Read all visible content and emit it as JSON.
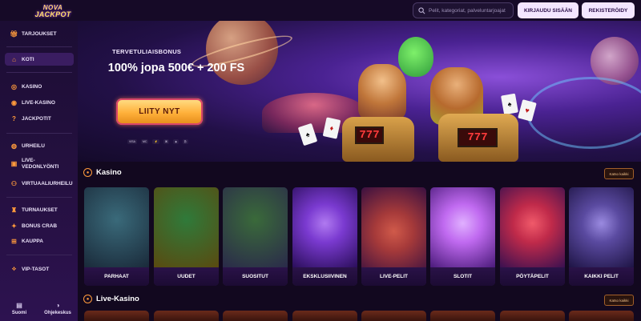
{
  "header": {
    "logo_line1": "NOVA",
    "logo_line2": "JACKPOT",
    "search_placeholder": "Pelit, kategoriat, palveluntarjoajat",
    "login_label": "KIRJAUDU SISÄÄN",
    "register_label": "REKISTERÖIDY"
  },
  "sidebar": {
    "items": [
      {
        "label": "TARJOUKSET",
        "icon": "gift-icon"
      },
      {
        "label": "KOTI",
        "icon": "home-icon",
        "active": true
      },
      {
        "label": "KASINO",
        "icon": "casino-chip-icon"
      },
      {
        "label": "LIVE-KASINO",
        "icon": "live-icon"
      },
      {
        "label": "JACKPOTIT",
        "icon": "jackpot-icon"
      },
      {
        "label": "URHEILU",
        "icon": "sports-icon"
      },
      {
        "label": "LIVE-VEDONLYÖNTI",
        "icon": "live-betting-icon"
      },
      {
        "label": "VIRTUAALIURHEILU",
        "icon": "virtual-sports-icon"
      },
      {
        "label": "TURNAUKSET",
        "icon": "trophy-icon"
      },
      {
        "label": "BONUS CRAB",
        "icon": "crab-icon"
      },
      {
        "label": "KAUPPA",
        "icon": "shop-icon"
      },
      {
        "label": "VIP-TASOT",
        "icon": "vip-icon"
      }
    ],
    "bottom": {
      "language_label": "Suomi",
      "help_label": "Ohjekeskus"
    }
  },
  "hero": {
    "kicker": "TERVETULIAISBONUS",
    "title": "100% jopa 500€ + 200 FS",
    "cta_label": "LIITY NYT",
    "kart1_display": "777",
    "kart2_display": "777",
    "payments": [
      "VISA",
      "MC",
      "⚡",
      "⌘",
      "◈",
      "₿"
    ]
  },
  "sections": {
    "casino": {
      "title": "Kasino",
      "see_all": "Katso kaikki",
      "tiles": [
        {
          "label": "PARHAAT",
          "color1": "#3a6a7a",
          "color2": "#1a2a3a"
        },
        {
          "label": "UUDET",
          "color1": "#2f7a3a",
          "color2": "#5a4a10"
        },
        {
          "label": "SUOSITUT",
          "color1": "#3a6a3a",
          "color2": "#2a2a4a"
        },
        {
          "label": "EKSKLUSIIVINEN",
          "color1": "#7a3ad0",
          "color2": "#2a0e5a"
        },
        {
          "label": "LIVE-PELIT",
          "color1": "#a63a3a",
          "color2": "#3a1040"
        },
        {
          "label": "SLOTIT",
          "color1": "#c06af0",
          "color2": "#4a1a7a"
        },
        {
          "label": "PÖYTÄPELIT",
          "color1": "#c02a4a",
          "color2": "#3a1050"
        },
        {
          "label": "KAIKKI PELIT",
          "color1": "#5a4aa0",
          "color2": "#1e1444"
        }
      ]
    },
    "live_casino": {
      "title": "Live-Kasino",
      "see_all": "Katso kaikki"
    }
  }
}
